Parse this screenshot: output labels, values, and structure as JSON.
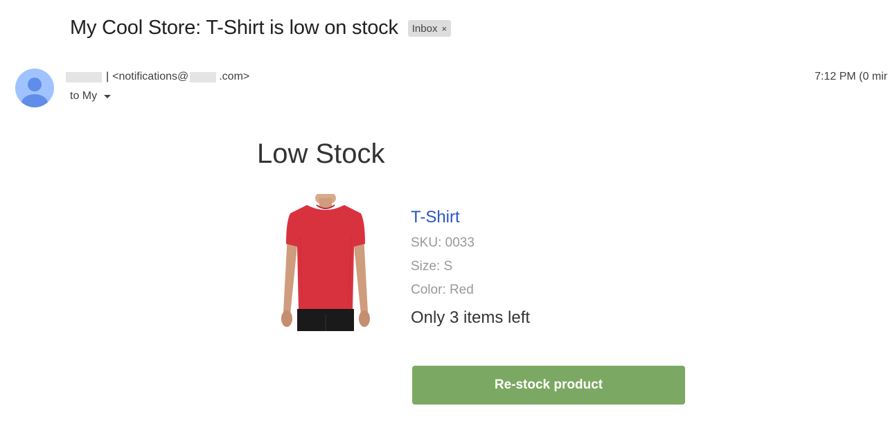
{
  "email": {
    "subject": "My Cool Store: T-Shirt is low on stock",
    "label_chip": "Inbox",
    "label_close": "×",
    "sender": {
      "email_prefix": "<notifications@",
      "email_suffix": ".com>",
      "separator": "|"
    },
    "recipient_line": "to My",
    "timestamp": "7:12 PM (0 mir"
  },
  "body": {
    "heading": "Low Stock",
    "product": {
      "name": "T-Shirt",
      "sku": "SKU: 0033",
      "size": "Size: S",
      "color": "Color: Red",
      "stock_note": "Only 3 items left",
      "image_icon": "red-tshirt-photo"
    },
    "button_label": "Re-stock product"
  },
  "colors": {
    "button": "#7ba862",
    "link": "#2a56c6",
    "avatar": "#a0c3ff",
    "avatar_figure": "#5f8de9",
    "shirt": "#d9323f"
  }
}
